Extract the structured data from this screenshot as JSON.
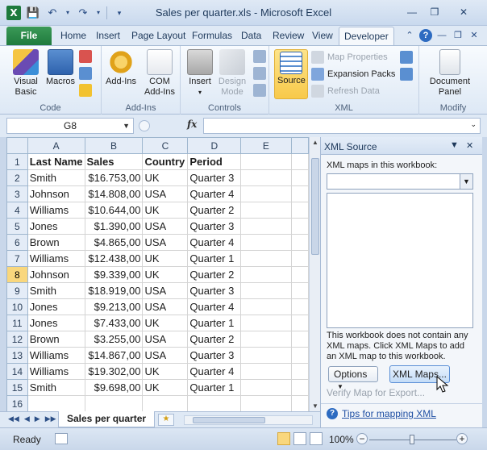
{
  "window": {
    "title": "Sales per quarter.xls  -  Microsoft Excel",
    "app_icon": "X"
  },
  "ribbon": {
    "tabs": [
      "File",
      "Home",
      "Insert",
      "Page Layout",
      "Formulas",
      "Data",
      "Review",
      "View",
      "Developer"
    ],
    "active_tab": "Developer",
    "groups": {
      "code": {
        "label": "Code",
        "visual_basic": "Visual Basic",
        "macros": "Macros"
      },
      "addins": {
        "label": "Add-Ins",
        "addins": "Add-Ins",
        "com_addins": "COM Add-Ins"
      },
      "controls": {
        "label": "Controls",
        "insert": "Insert",
        "design_mode": "Design Mode"
      },
      "xml": {
        "label": "XML",
        "source": "Source",
        "map_properties": "Map Properties",
        "expansion_packs": "Expansion Packs",
        "refresh_data": "Refresh Data"
      },
      "modify": {
        "label": "Modify",
        "document_panel": "Document Panel"
      }
    }
  },
  "formula_bar": {
    "name_box": "G8",
    "fx_label": "fx",
    "formula": ""
  },
  "sheet": {
    "columns": [
      "A",
      "B",
      "C",
      "D",
      "E"
    ],
    "rows": [
      {
        "num": "1",
        "cells": [
          "Last Name",
          "Sales",
          "Country",
          "Period",
          ""
        ]
      },
      {
        "num": "2",
        "cells": [
          "Smith",
          "$16.753,00",
          "UK",
          "Quarter 3",
          ""
        ]
      },
      {
        "num": "3",
        "cells": [
          "Johnson",
          "$14.808,00",
          "USA",
          "Quarter 4",
          ""
        ]
      },
      {
        "num": "4",
        "cells": [
          "Williams",
          "$10.644,00",
          "UK",
          "Quarter 2",
          ""
        ]
      },
      {
        "num": "5",
        "cells": [
          "Jones",
          "$1.390,00",
          "USA",
          "Quarter 3",
          ""
        ]
      },
      {
        "num": "6",
        "cells": [
          "Brown",
          "$4.865,00",
          "USA",
          "Quarter 4",
          ""
        ]
      },
      {
        "num": "7",
        "cells": [
          "Williams",
          "$12.438,00",
          "UK",
          "Quarter 1",
          ""
        ]
      },
      {
        "num": "8",
        "cells": [
          "Johnson",
          "$9.339,00",
          "UK",
          "Quarter 2",
          ""
        ]
      },
      {
        "num": "9",
        "cells": [
          "Smith",
          "$18.919,00",
          "USA",
          "Quarter 3",
          ""
        ]
      },
      {
        "num": "10",
        "cells": [
          "Jones",
          "$9.213,00",
          "USA",
          "Quarter 4",
          ""
        ]
      },
      {
        "num": "11",
        "cells": [
          "Jones",
          "$7.433,00",
          "UK",
          "Quarter 1",
          ""
        ]
      },
      {
        "num": "12",
        "cells": [
          "Brown",
          "$3.255,00",
          "USA",
          "Quarter 2",
          ""
        ]
      },
      {
        "num": "13",
        "cells": [
          "Williams",
          "$14.867,00",
          "USA",
          "Quarter 3",
          ""
        ]
      },
      {
        "num": "14",
        "cells": [
          "Williams",
          "$19.302,00",
          "UK",
          "Quarter 4",
          ""
        ]
      },
      {
        "num": "15",
        "cells": [
          "Smith",
          "$9.698,00",
          "UK",
          "Quarter 1",
          ""
        ]
      },
      {
        "num": "16",
        "cells": [
          "",
          "",
          "",
          "",
          ""
        ]
      }
    ],
    "selected_row": "8",
    "sheet_tab": "Sales per quarter"
  },
  "xml_pane": {
    "title": "XML Source",
    "maps_label": "XML maps in this workbook:",
    "info": "This workbook does not contain any XML maps. Click XML Maps to add an XML map to this workbook.",
    "options_button": "Options",
    "xml_maps_button": "XML Maps...",
    "verify_link": "Verify Map for Export...",
    "tips_link": "Tips for mapping XML"
  },
  "status_bar": {
    "ready": "Ready",
    "zoom": "100%",
    "zoom_level_percent": 100
  },
  "colors": {
    "file_tab": "#1f7a3d",
    "source_active": "#f8c94a",
    "selected_header": "#f9d77d"
  }
}
